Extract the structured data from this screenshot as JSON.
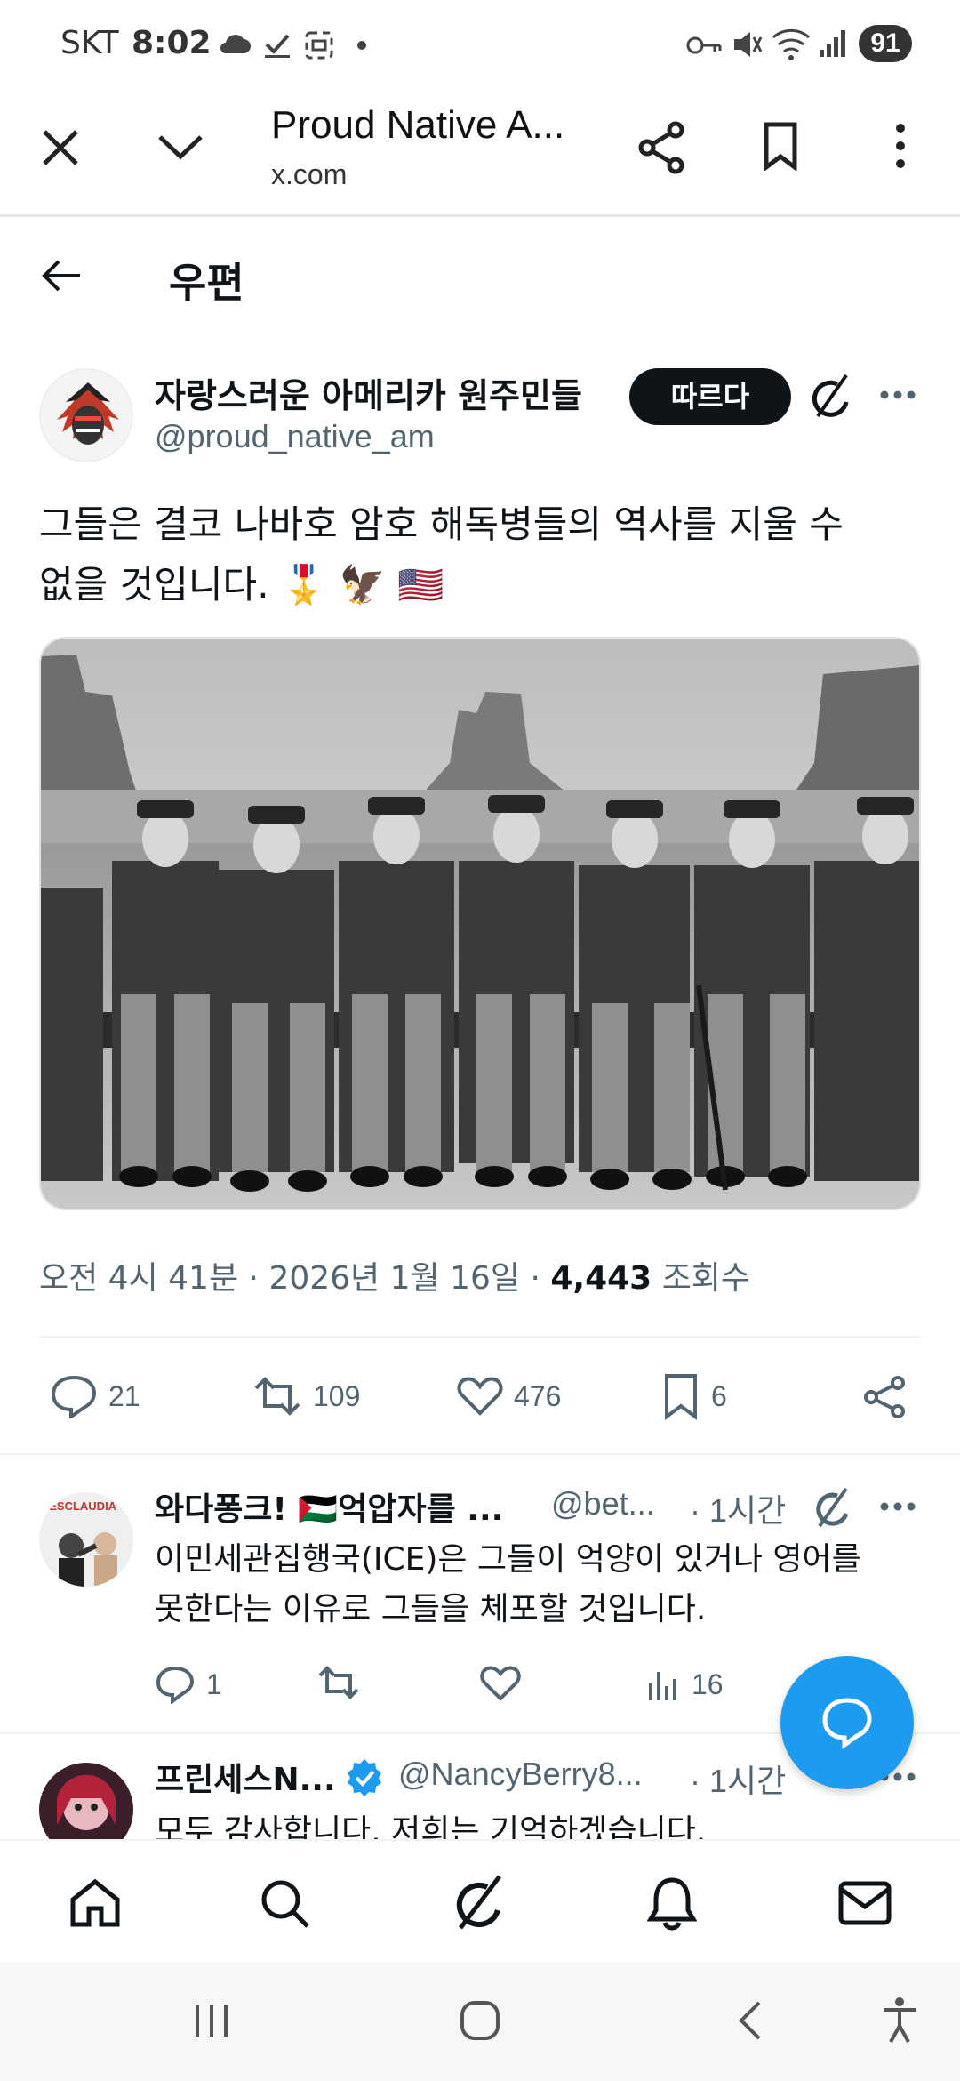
{
  "status_bar": {
    "carrier": "SKT",
    "time": "8:02",
    "battery": "91"
  },
  "browser": {
    "title": "Proud Native A...",
    "url": "x.com"
  },
  "page": {
    "heading": "우편"
  },
  "post": {
    "author_name": "자랑스러운 아메리카 원주민들",
    "author_handle": "@proud_native_am",
    "follow_label": "따르다",
    "text_line1": "그들은 결코 나바호 암호 해독병들의 역사를 지울 수",
    "text_line2": "없을 것입니다. 🎖️ 🦅 🇺🇸",
    "time": "오전 4시 41분",
    "date": "2026년 1월 16일",
    "views": "4,443",
    "views_label": "조회수",
    "replies": "21",
    "reposts": "109",
    "likes": "476",
    "bookmarks": "6"
  },
  "replies": [
    {
      "name": "와다퐁크! 🇵🇸억압자를 ...",
      "handle": "@bet...",
      "time": "· 1시간",
      "avatar_text": "#ESCLAUDIA",
      "text_line1": "이민세관집행국(ICE)은 그들이 억양이 있거나 영어를",
      "text_line2": "못한다는 이유로 그들을 체포할 것입니다.",
      "reply_count": "1",
      "views": "16"
    },
    {
      "name": "프린세스N...",
      "handle": "@NancyBerry8...",
      "time": "· 1시간",
      "text_line1": "모두 감사합니다. 저희는 기억하겠습니다."
    }
  ],
  "colors": {
    "accent": "#1d9bf0",
    "text": "#0f1419",
    "muted": "#536471",
    "verified": "#1d9bf0"
  }
}
